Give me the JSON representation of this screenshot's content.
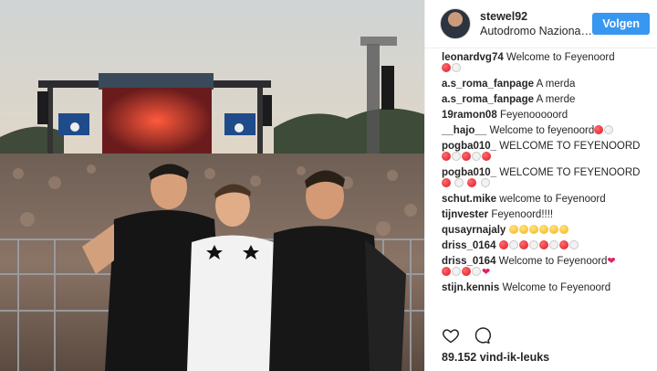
{
  "post": {
    "username": "stewel92",
    "location": "Autodromo Nazionale...",
    "follow_label": "Volgen",
    "likes": "89.152 vind-ik-leuks"
  },
  "comments": [
    {
      "user": "leonardvg74",
      "text": "Welcome to Feyenoord"
    },
    {
      "user": "a.s_roma_fanpage",
      "text": "A merda"
    },
    {
      "user": "a.s_roma_fanpage",
      "text": "A merde"
    },
    {
      "user": "19ramon08",
      "text": "Feyenooooord"
    },
    {
      "user": "__hajo__",
      "text": "Welcome to feyenoord"
    },
    {
      "user": "pogba010_",
      "text": "WELCOME TO FEYENOORD"
    },
    {
      "user": "pogba010_",
      "text": "WELCOME TO FEYENOORD"
    },
    {
      "user": "schut.mike",
      "text": "welcome to Feyenoord"
    },
    {
      "user": "tijnvester",
      "text": "Feyenoord!!!!"
    },
    {
      "user": "qusayrnajaly",
      "text": ""
    },
    {
      "user": "driss_0164",
      "text": ""
    },
    {
      "user": "driss_0164",
      "text": "Welcome to Feyenoord"
    },
    {
      "user": "stijn.kennis",
      "text": "Welcome to Feyenoord"
    }
  ],
  "icons": {
    "like": "heart-icon",
    "comment": "comment-icon"
  },
  "colors": {
    "follow_button": "#3897f0",
    "text": "#262626"
  }
}
